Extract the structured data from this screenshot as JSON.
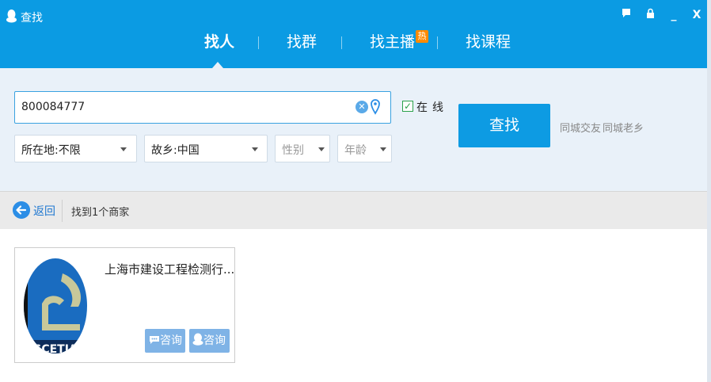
{
  "window": {
    "title": "查找",
    "controls": {
      "feedback": "▪",
      "lock": "▪",
      "minimize": "_",
      "close": "X"
    }
  },
  "tabs": [
    {
      "label": "找人",
      "active": true
    },
    {
      "label": "找群",
      "active": false
    },
    {
      "label": "找主播",
      "active": false,
      "badge": "热"
    },
    {
      "label": "找课程",
      "active": false
    }
  ],
  "search": {
    "value": "800084777",
    "clear_icon": "x-circle-icon",
    "location_icon": "map-pin-icon",
    "online_checked": true,
    "online_label": "在线",
    "button_label": "查找",
    "quick_links": [
      "同城交友",
      "同城老乡"
    ]
  },
  "filters": [
    {
      "label": "所在地:不限",
      "muted": false
    },
    {
      "label": "故乡:中国",
      "muted": false
    },
    {
      "label": "性别",
      "muted": true
    },
    {
      "label": "年龄",
      "muted": true
    }
  ],
  "results_bar": {
    "back_label": "返回",
    "count_text": "找到1个商家"
  },
  "result_card": {
    "name": "上海市建设工程检测行...",
    "logo_text": "SCETIA",
    "consult_buttons": [
      "咨询",
      "咨询"
    ]
  },
  "colors": {
    "brand_blue": "#0b9be3",
    "panel_bg": "#e9f1f9",
    "consult_bg": "#7fb3e6",
    "hot_badge": "#ff8a00"
  }
}
